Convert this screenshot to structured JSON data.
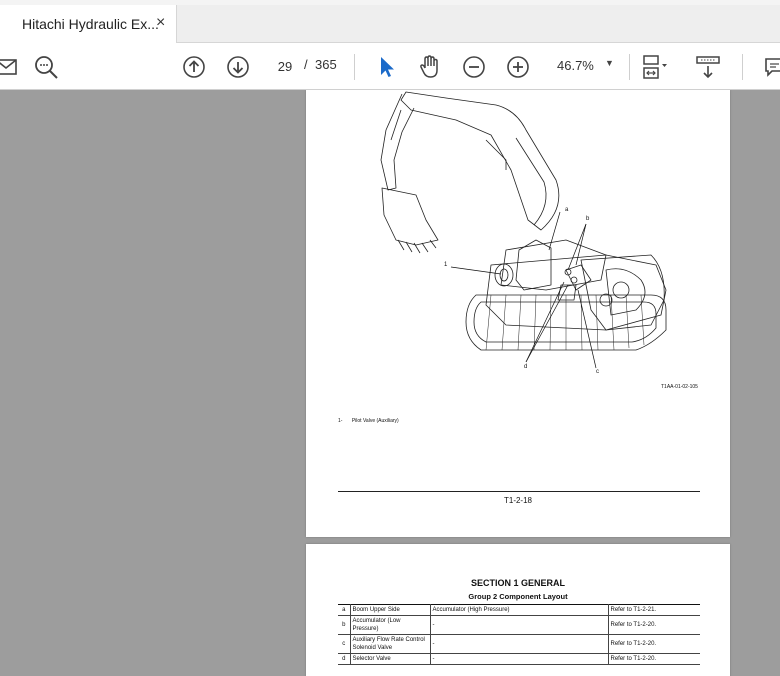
{
  "tab": {
    "title": "Hitachi Hydraulic Ex...",
    "close_glyph": "×"
  },
  "toolbar": {
    "current_page": "29",
    "separator": "/",
    "total_pages": "365",
    "zoom": "46.7%",
    "icons": [
      "mail-icon",
      "search-icon",
      "page-up-icon",
      "page-down-icon",
      "select-cursor-icon",
      "hand-tool-icon",
      "zoom-out-icon",
      "zoom-in-icon",
      "zoom-dropdown-caret-icon",
      "fit-page-icon",
      "scroll-mode-icon",
      "comment-icon"
    ],
    "accent_color": "#1b6ac9"
  },
  "page1": {
    "annotations": {
      "a": "a",
      "b": "b",
      "one": "1",
      "d": "d",
      "c": "c"
    },
    "figure_id": "T1AA-01-02-105",
    "caption_num": "1-",
    "caption_text": "Pilot Valve (Auxiliary)",
    "page_number": "T1-2-18"
  },
  "page2": {
    "section_title": "SECTION 1 GENERAL",
    "group_title": "Group 2 Component Layout",
    "rows": [
      {
        "id": "a",
        "name": "Boom Upper Side",
        "note": "Accumulator (High Pressure)",
        "ref": "Refer to T1-2-21."
      },
      {
        "id": "b",
        "name": "Accumulator (Low Pressure)",
        "note": "-",
        "ref": "Refer to T1-2-20."
      },
      {
        "id": "c",
        "name": "Auxiliary Flow Rate Control Solenoid Valve",
        "note": "-",
        "ref": "Refer to T1-2-20."
      },
      {
        "id": "d",
        "name": "Selector Valve",
        "note": "-",
        "ref": "Refer to T1-2-20."
      }
    ]
  }
}
